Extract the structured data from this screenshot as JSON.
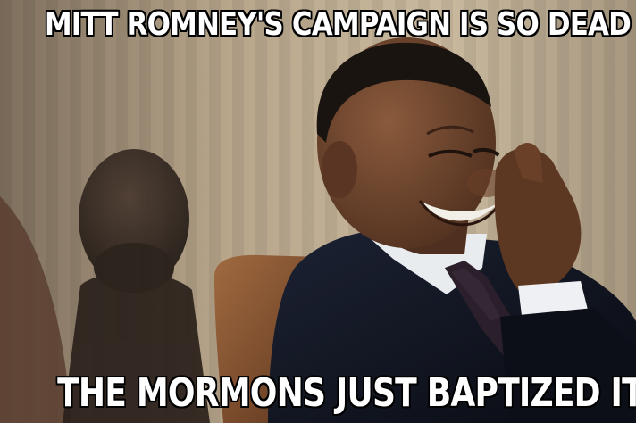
{
  "meme": {
    "top_text": "MITT ROMNEY'S CAMPAIGN IS SO DEAD",
    "bottom_text": "THE MORMONS JUST BAPTIZED IT"
  },
  "scene": {
    "background_color": "#b9a88e",
    "suit_color": "#111522",
    "tie_color": "#2a1f2a",
    "chair_color": "#7a4a2c",
    "bust_color": "#2e2520"
  }
}
